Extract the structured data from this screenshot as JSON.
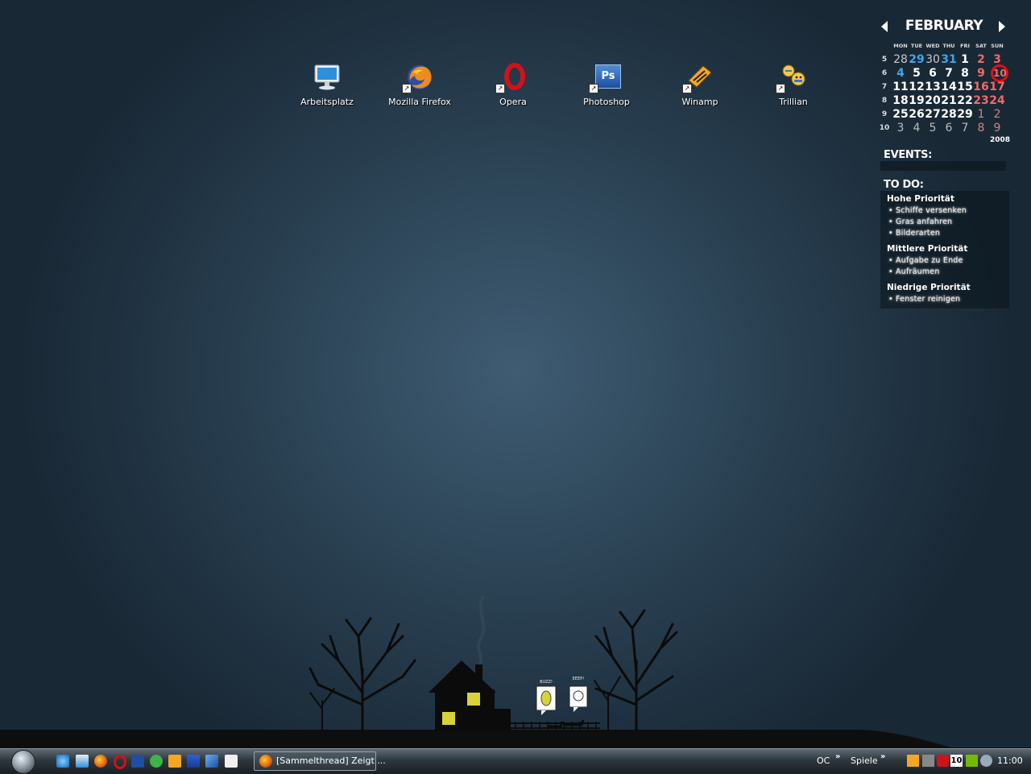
{
  "desktop_icons": [
    {
      "label": "Arbeitsplatz",
      "icon": "computer-icon"
    },
    {
      "label": "Mozilla Firefox",
      "icon": "firefox-icon"
    },
    {
      "label": "Opera",
      "icon": "opera-icon"
    },
    {
      "label": "Photoshop",
      "icon": "photoshop-icon"
    },
    {
      "label": "Winamp",
      "icon": "winamp-icon"
    },
    {
      "label": "Trillian",
      "icon": "trillian-icon"
    }
  ],
  "photoshop_glyph": "Ps",
  "calendar": {
    "month": "FEBRUARY",
    "year": "2008",
    "day_names": [
      "MON",
      "TUE",
      "WED",
      "THU",
      "FRI",
      "SAT",
      "SUN"
    ],
    "weeks": [
      {
        "num": "5",
        "days": [
          "28",
          "29",
          "30",
          "31",
          "1",
          "2",
          "3"
        ]
      },
      {
        "num": "6",
        "days": [
          "4",
          "5",
          "6",
          "7",
          "8",
          "9",
          "10"
        ]
      },
      {
        "num": "7",
        "days": [
          "11",
          "12",
          "13",
          "14",
          "15",
          "16",
          "17"
        ]
      },
      {
        "num": "8",
        "days": [
          "18",
          "19",
          "20",
          "21",
          "22",
          "23",
          "24"
        ]
      },
      {
        "num": "9",
        "days": [
          "25",
          "26",
          "27",
          "28",
          "29",
          "1",
          "2"
        ]
      },
      {
        "num": "10",
        "days": [
          "3",
          "4",
          "5",
          "6",
          "7",
          "8",
          "9"
        ]
      }
    ],
    "today": "10"
  },
  "events": {
    "title": "EVENTS:"
  },
  "todo": {
    "title": "TO DO:",
    "groups": [
      {
        "priority": "Hohe Priorität",
        "items": [
          "Schiffe versenken",
          "Gras anfahren",
          "Bilderarten"
        ]
      },
      {
        "priority": "Mittlere Priorität",
        "items": [
          "Aufgabe zu Ende",
          "Aufräumen"
        ]
      },
      {
        "priority": "Niedrige Priorität",
        "items": [
          "Fenster reinigen"
        ]
      }
    ]
  },
  "scene": {
    "bubble_left": "BUZZ!",
    "bubble_right": "EEEP!"
  },
  "taskbar": {
    "active_window": "[Sammelthread] Zeigt ...",
    "toolbars": [
      "OC",
      "Spiele"
    ],
    "chevron": "»",
    "tray_badge": "10",
    "clock": "11:00"
  },
  "colors": {
    "desktop_bg": "#2c4456",
    "calendar_highlight": "#e01010",
    "calendar_blue": "#3fa6e6",
    "calendar_weekend": "#f06a6a",
    "window_light": "#d8d23a"
  }
}
